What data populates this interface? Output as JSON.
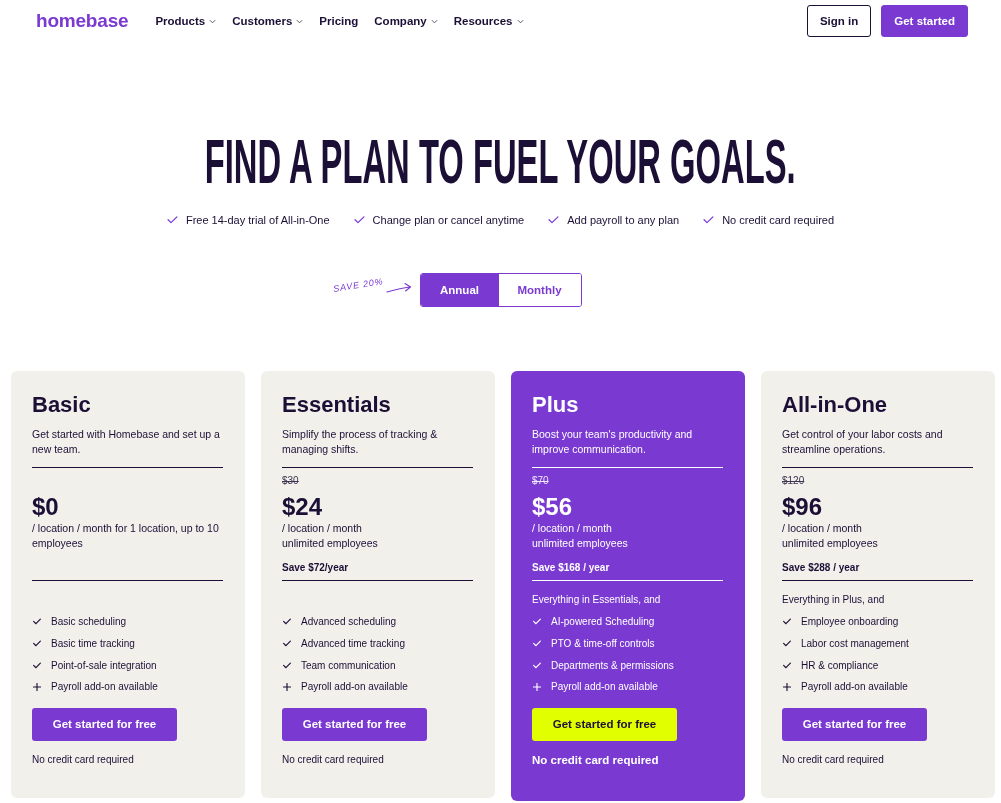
{
  "nav": {
    "logo": "homebase",
    "items": [
      {
        "label": "Products",
        "dropdown": true
      },
      {
        "label": "Customers",
        "dropdown": true
      },
      {
        "label": "Pricing",
        "dropdown": false
      },
      {
        "label": "Company",
        "dropdown": true
      },
      {
        "label": "Resources",
        "dropdown": true
      }
    ],
    "sign_in": "Sign in",
    "get_started": "Get started"
  },
  "hero": {
    "title": "FIND A PLAN TO FUEL YOUR GOALS.",
    "perks": [
      "Free 14-day trial of All-in-One",
      "Change plan or cancel anytime",
      "Add payroll to any plan",
      "No credit card required"
    ]
  },
  "billing": {
    "note": "SAVE 20%",
    "options": [
      {
        "label": "Annual",
        "selected": true
      },
      {
        "label": "Monthly",
        "selected": false
      }
    ]
  },
  "plans": [
    {
      "name": "Basic",
      "highlighted": false,
      "description": "Get started with Homebase and set up a new team.",
      "price": "$0",
      "price_note": "/ location / month for 1 location, up to 10 employees",
      "features": [
        {
          "kind": "check",
          "label": "Basic scheduling"
        },
        {
          "kind": "check",
          "label": "Basic time tracking"
        },
        {
          "kind": "check",
          "label": "Point-of-sale integration"
        },
        {
          "kind": "plus",
          "label": "Payroll add-on available"
        }
      ],
      "cta": "Get started for free",
      "footnote": "No credit card required"
    },
    {
      "name": "Essentials",
      "highlighted": false,
      "description": "Simplify the process of tracking & managing shifts.",
      "old_price": "$30",
      "price": "$24",
      "price_note": "/ location / month\nunlimited employees",
      "savings": "Save $72/year",
      "features": [
        {
          "kind": "check",
          "label": "Advanced scheduling"
        },
        {
          "kind": "check",
          "label": "Advanced time tracking"
        },
        {
          "kind": "check",
          "label": "Team communication"
        },
        {
          "kind": "plus",
          "label": "Payroll add-on available"
        }
      ],
      "cta": "Get started for free",
      "footnote": "No credit card required"
    },
    {
      "name": "Plus",
      "highlighted": true,
      "description": "Boost your team's productivity and improve communication.",
      "old_price": "$70",
      "price": "$56",
      "price_note": "/ location / month\nunlimited employees",
      "savings": "Save $168 / year",
      "features_intro": "Everything in Essentials, and",
      "features": [
        {
          "kind": "check",
          "label": "AI-powered Scheduling"
        },
        {
          "kind": "check",
          "label": "PTO & time-off controls"
        },
        {
          "kind": "check",
          "label": "Departments & permissions"
        },
        {
          "kind": "plus",
          "label": "Payroll add-on available"
        }
      ],
      "cta": "Get started for free",
      "footnote": "No credit card required"
    },
    {
      "name": "All-in-One",
      "highlighted": false,
      "description": "Get control of your labor costs and streamline operations.",
      "old_price": "$120",
      "price": "$96",
      "price_note": "/ location / month\nunlimited employees",
      "savings": "Save $288 / year",
      "features_intro": "Everything in Plus, and",
      "features": [
        {
          "kind": "check",
          "label": "Employee onboarding"
        },
        {
          "kind": "check",
          "label": "Labor cost management"
        },
        {
          "kind": "check",
          "label": "HR & compliance"
        },
        {
          "kind": "plus",
          "label": "Payroll add-on available"
        }
      ],
      "cta": "Get started for free",
      "footnote": "No credit card required"
    }
  ]
}
